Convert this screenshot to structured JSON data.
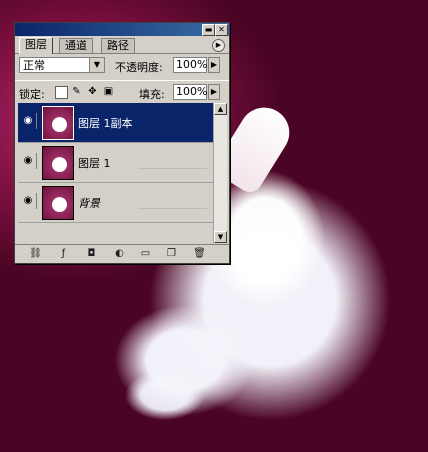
{
  "panel": {
    "tabs": [
      {
        "label": "图层"
      },
      {
        "label": "通道"
      },
      {
        "label": "路径"
      }
    ],
    "blend_mode": "正常",
    "opacity_label": "不透明度:",
    "opacity_value": "100%",
    "lock_label": "锁定:",
    "fill_label": "填充:",
    "fill_value": "100%",
    "layers": [
      {
        "name": "图层 1副本",
        "selected": true
      },
      {
        "name": "图层 1",
        "selected": false
      },
      {
        "name": "背景",
        "selected": false
      }
    ]
  },
  "icons": {
    "minimize": "minimize-icon",
    "close": "close-icon",
    "palette_menu": "palette-menu-icon",
    "eye": "eye-icon",
    "link": "link-icon",
    "style": "layer-style-icon",
    "mask": "mask-icon",
    "adjust": "adjustment-icon",
    "folder": "folder-icon",
    "new_layer": "new-layer-icon",
    "trash": "trash-icon"
  },
  "colors": {
    "titlebar": "#0a246a",
    "panel_bg": "#d4d0c8",
    "selection": "#0a246a"
  }
}
